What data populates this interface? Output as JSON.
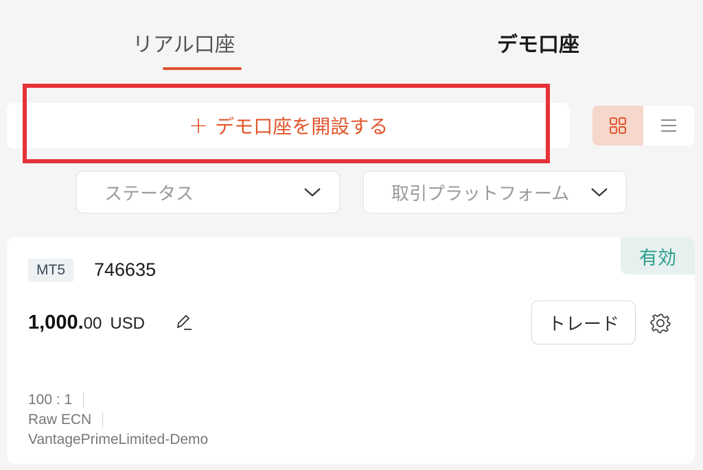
{
  "tabs": {
    "real": "リアル口座",
    "demo": "デモ口座"
  },
  "open_demo": {
    "plus": "+",
    "label": "デモ口座を開設する"
  },
  "view_toggle": {
    "active": "grid-view",
    "options": [
      "grid-view",
      "list-view"
    ]
  },
  "filters": {
    "status_placeholder": "ステータス",
    "platform_placeholder": "取引プラットフォーム"
  },
  "account": {
    "status_badge": "有効",
    "platform": "MT5",
    "number": "746635",
    "balance_int": "1,000.",
    "balance_dec": "00",
    "currency": "USD",
    "trade_label": "トレード",
    "leverage": "100 : 1",
    "account_type": "Raw ECN",
    "server": "VantagePrimeLimited-Demo"
  },
  "colors": {
    "accent": "#e0552c",
    "highlight_box": "#e53238",
    "active_badge_text": "#2a9d8f",
    "active_badge_bg": "#e6f1ef",
    "toggle_active_bg": "#f6d7cc"
  }
}
